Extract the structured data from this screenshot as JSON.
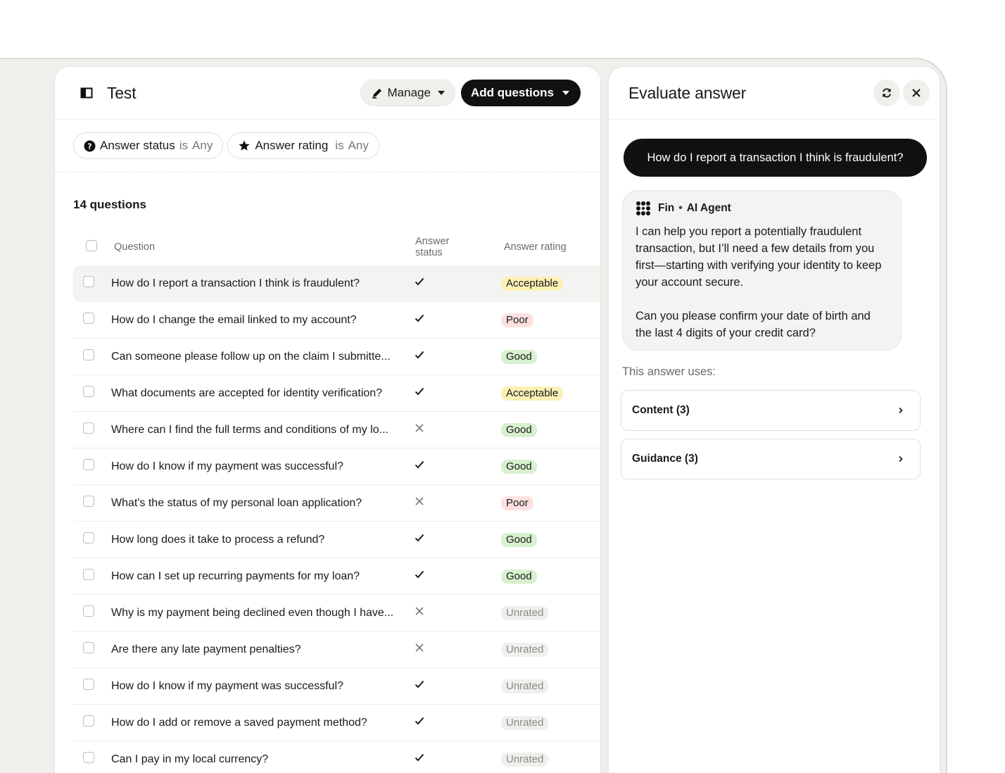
{
  "colors": {
    "badge_acceptable_bg": "#fbf0b5",
    "badge_poor_bg": "#fde0e0",
    "badge_good_bg": "#d7f0cf",
    "badge_unrated_bg": "#efefec",
    "badge_unrated_text": "#8a8a8a",
    "accent_dark": "#111111"
  },
  "left_panel": {
    "title": "Test",
    "manage_label": "Manage",
    "add_questions_label": "Add questions",
    "filters": [
      {
        "label": "Answer status",
        "op": "is",
        "value": "Any",
        "icon": "question-circle-icon"
      },
      {
        "label": "Answer rating",
        "op": "is",
        "value": "Any",
        "icon": "star-icon"
      }
    ],
    "count_label": "14 questions",
    "columns": {
      "question": "Question",
      "status_line1": "Answer",
      "status_line2": "status",
      "rating": "Answer rating"
    },
    "rows": [
      {
        "question": "How do I report a transaction I think is fraudulent?",
        "status": "check",
        "rating": "Acceptable"
      },
      {
        "question": "How do I change the email linked to my account?",
        "status": "check",
        "rating": "Poor"
      },
      {
        "question": "Can someone please follow up on the claim I submitte...",
        "status": "check",
        "rating": "Good"
      },
      {
        "question": "What documents are accepted for identity verification?",
        "status": "check",
        "rating": "Acceptable"
      },
      {
        "question": "Where can I find the full terms and conditions of my lo...",
        "status": "cross",
        "rating": "Good"
      },
      {
        "question": "How do I know if my payment was successful?",
        "status": "check",
        "rating": "Good"
      },
      {
        "question": "What's the status of my personal loan application?",
        "status": "cross",
        "rating": "Poor"
      },
      {
        "question": "How long does it take to process a refund?",
        "status": "check",
        "rating": "Good"
      },
      {
        "question": "How can I set up recurring payments for my loan?",
        "status": "check",
        "rating": "Good"
      },
      {
        "question": "Why is my payment being declined even though I have...",
        "status": "cross",
        "rating": "Unrated"
      },
      {
        "question": "Are there any late payment penalties?",
        "status": "cross",
        "rating": "Unrated"
      },
      {
        "question": "How do I know if my payment was successful?",
        "status": "check",
        "rating": "Unrated"
      },
      {
        "question": "How do I add or remove a saved payment method?",
        "status": "check",
        "rating": "Unrated"
      },
      {
        "question": "Can I pay in my local currency?",
        "status": "check",
        "rating": "Unrated"
      }
    ]
  },
  "right_panel": {
    "title": "Evaluate answer",
    "user_message": "How do I report a transaction I think is fraudulent?",
    "agent_name": "Fin",
    "agent_separator": "•",
    "agent_role": "AI Agent",
    "agent_paragraph1": "I can help you report a potentially fraudulent transaction, but I’ll need a few details from you first—starting with verifying your identity to keep your account secure.",
    "agent_paragraph2": "Can you please confirm your date of birth and the last 4 digits of your credit card?",
    "uses_label": "This answer uses:",
    "sources": [
      {
        "label": "Content (3)"
      },
      {
        "label": "Guidance (3)"
      }
    ]
  }
}
